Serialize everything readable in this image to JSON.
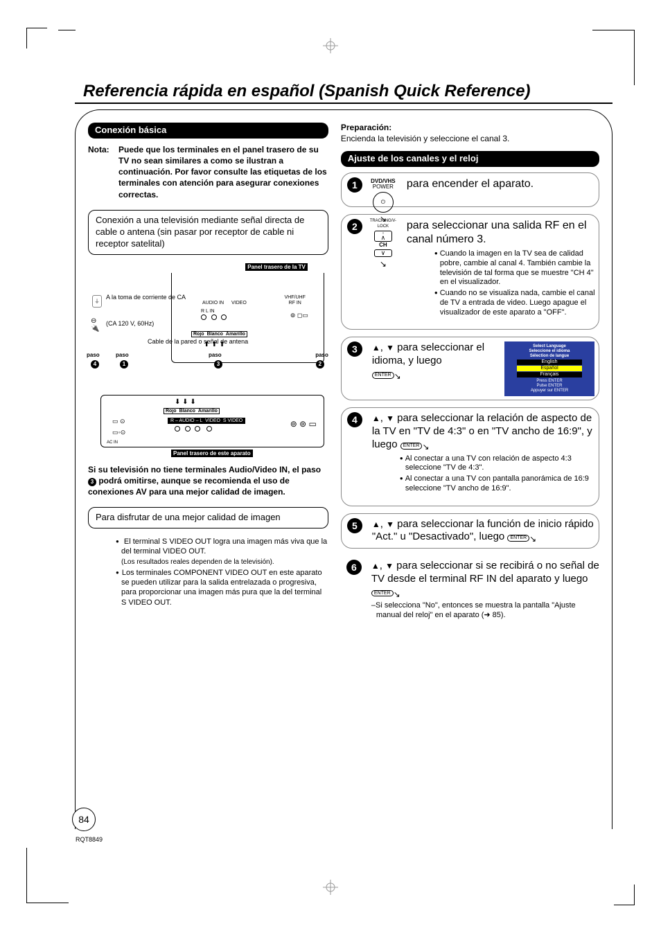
{
  "doc": {
    "title": "Referencia rápida en español (Spanish Quick Reference)",
    "pageNumber": "84",
    "docId": "RQT8849"
  },
  "left": {
    "h_basic": "Conexión básica",
    "nota_label": "Nota:",
    "nota_body": "Puede que los terminales en el panel trasero de su TV no sean similares a como se ilustran a continuación. Por favor consulte las etiquetas de los terminales con atención para asegurar conexiones correctas.",
    "box_direct": "Conexión a una televisión mediante señal directa de cable o antena (sin pasar por receptor de cable ni receptor satelital)",
    "diagram": {
      "tv_panel": "Panel trasero de la TV",
      "unit_panel": "Panel trasero de este aparato",
      "rgb": [
        "Rojo",
        "Blanco",
        "Amarillo"
      ],
      "audio_in": "AUDIO IN",
      "video": "VIDEO",
      "rl_in": "R    L    IN",
      "vhf_uhf": "VHF/UHF",
      "rf_in": "RF IN",
      "ac_label": "A la toma de corriente de CA",
      "ac_spec": "(CA 120 V, 60Hz)",
      "cable_label": "Cable de la pared o señal de antena",
      "step_word": "paso",
      "svideo": "S VIDEO\nOUT",
      "acin": "AC IN"
    },
    "note_skip_pre": "Si su televisión no tiene terminales Audio/Video IN, el paso ",
    "note_skip_post": " podrá omitirse, aunque se recomienda el uso de conexiones AV para una mejor calidad de imagen.",
    "box_quality": "Para disfrutar de una mejor calidad de imagen",
    "bul_svideo": "El terminal S VIDEO OUT logra una imagen más viva que la del terminal VIDEO OUT.",
    "bul_svideo_sub": "(Los resultados reales dependen de la televisión).",
    "bul_component": "Los terminales COMPONENT VIDEO OUT en este aparato se pueden utilizar para la salida entrelazada o progresiva, para proporcionar una imagen más pura que la del terminal S VIDEO OUT."
  },
  "right": {
    "prep_label": "Preparación:",
    "prep_body": "Encienda la televisión y seleccione el canal 3.",
    "h_clock": "Ajuste de los canales y el reloj",
    "step1": {
      "btn_top": "DVD/VHS",
      "btn_bot": "POWER",
      "main": "para encender el aparato."
    },
    "step2": {
      "lbl": "TRACKING/V-LOCK",
      "ch": "CH",
      "main": "para seleccionar una salida RF en el canal número 3.",
      "b1": "Cuando la imagen en la TV sea de calidad pobre, cambie al canal 4. También cambie la televisión de tal forma que se muestre \"CH 4\" en el visualizador.",
      "b2": "Cuando no se visualiza nada, cambie el canal de TV a entrada de video. Luego apague el visualizador de este aparato a \"OFF\"."
    },
    "step3": {
      "main_a": ", ",
      "main_b": " para seleccionar el idioma, y luego ",
      "enter": "ENTER",
      "osd": {
        "t1": "Select Language",
        "t2": "Seleccione el idioma",
        "t3": "Sélection de langue",
        "o1": "English",
        "o2": "Español",
        "o3": "Français",
        "f1": "Press ENTER",
        "f2": "Pulse ENTER",
        "f3": "Appuyer sur ENTER"
      }
    },
    "step4": {
      "main": " para seleccionar la relación de aspecto de la TV en \"TV de 4:3\" o en \"TV ancho de 16:9\", y luego ",
      "b1": "Al conectar a una TV con relación de aspecto 4:3 seleccione \"TV de 4:3\".",
      "b2": "Al conectar a una TV con pantalla panorámica de 16:9 seleccione \"TV ancho de 16:9\"."
    },
    "step5": {
      "main": " para seleccionar la función de inicio rápido \"Act.\" u \"Desactivado\", luego "
    },
    "step6": {
      "main": " para seleccionar si se recibirá o no señal de TV desde el terminal RF IN del aparato y luego ",
      "dash": "–Si selecciona \"No\", entonces se muestra la pantalla \"Ajuste manual del reloj\" en el aparato (➜ 85)."
    }
  }
}
